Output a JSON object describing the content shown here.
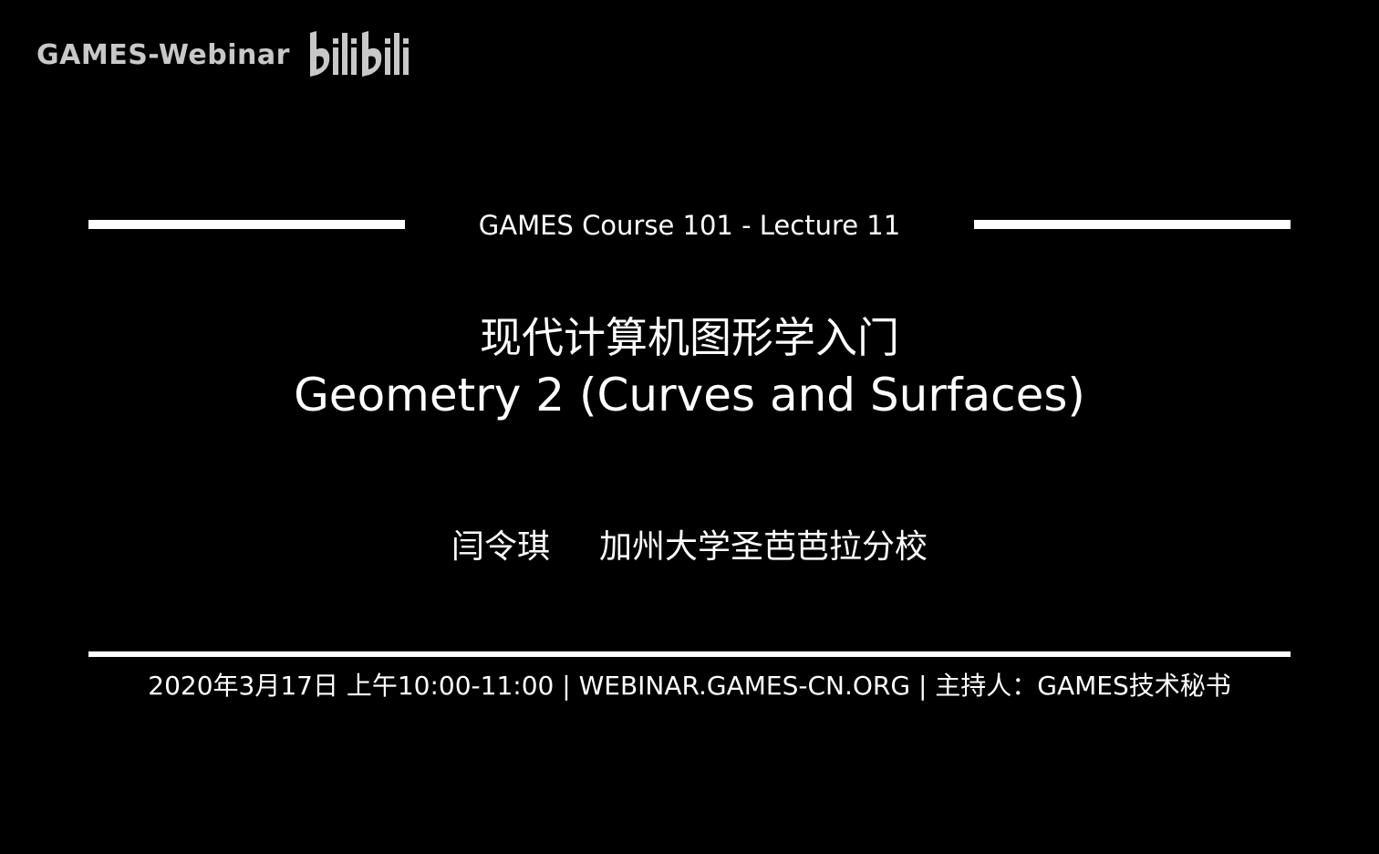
{
  "watermark": {
    "text": "GAMES-Webinar",
    "logo_icon": "bilibili-logo-icon",
    "logo_text": "bilibili",
    "color": "#c8c8c8"
  },
  "slide": {
    "course_line": "GAMES Course 101 - Lecture 11",
    "title_cn": "现代计算机图形学入门",
    "title_en": "Geometry 2 (Curves and Surfaces)",
    "presenter_name": "闫令琪",
    "presenter_affiliation": "加州大学圣芭芭拉分校",
    "footer": "2020年3月17日 上午10:00-11:00 | WEBINAR.GAMES-CN.ORG | 主持人：GAMES技术秘书"
  },
  "colors": {
    "background": "#000000",
    "foreground": "#ffffff"
  }
}
